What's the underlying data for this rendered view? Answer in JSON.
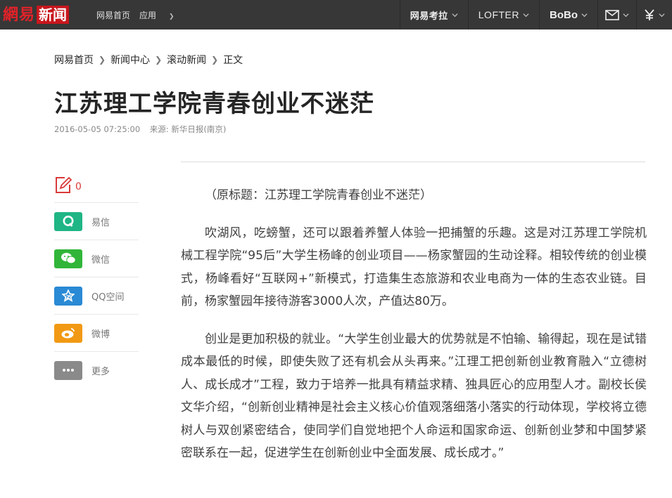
{
  "topbar": {
    "logo_main": "網易",
    "logo_sub": "新闻",
    "nav_home": "网易首页",
    "nav_apps": "应用",
    "kaola": "网易考拉",
    "lofter": "LOFTER",
    "bobo": "BoBo"
  },
  "colors": {
    "topbar_bg": "#373737",
    "logo_red": "#c8161d",
    "yixin": "#1fb585",
    "weixin": "#31b539",
    "qzone": "#2a8ad5",
    "weibo": "#f29913",
    "more": "#8a8a8a"
  },
  "breadcrumb": [
    "网易首页",
    "新闻中心",
    "滚动新闻",
    "正文"
  ],
  "article": {
    "title": "江苏理工学院青春创业不迷茫",
    "datetime": "2016-05-05 07:25:00",
    "source": "来源: 新华日报(南京)",
    "paragraphs": [
      "（原标题：江苏理工学院青春创业不迷茫）",
      "吹湖风，吃螃蟹，还可以跟着养蟹人体验一把捕蟹的乐趣。这是对江苏理工学院机械工程学院“95后”大学生杨峰的创业项目——杨家蟹园的生动诠释。相较传统的创业模式，杨峰看好“互联网+”新模式，打造集生态旅游和农业电商为一体的生态农业链。目前，杨家蟹园年接待游客3000人次，产值达80万。",
      "创业是更加积极的就业。“大学生创业最大的优势就是不怕输、输得起，现在是试错成本最低的时候，即使失败了还有机会从头再来。”江理工把创新创业教育融入“立德树人、成长成才”工程，致力于培养一批具有精益求精、独具匠心的应用型人才。副校长侯文华介绍，“创新创业精神是社会主义核心价值观落细落小落实的行动体现，学校将立德树人与双创紧密结合，使同学们自觉地把个人命运和国家命运、创新创业梦和中国梦紧密联系在一起，促进学生在创新创业中全面发展、成长成才。”"
    ]
  },
  "comments": {
    "count": "0",
    "icon": "comment-edit-icon"
  },
  "share": [
    {
      "label": "易信",
      "icon": "yixin-icon"
    },
    {
      "label": "微信",
      "icon": "wechat-icon"
    },
    {
      "label": "QQ空间",
      "icon": "qzone-icon"
    },
    {
      "label": "微博",
      "icon": "weibo-icon"
    },
    {
      "label": "更多",
      "icon": "more-icon"
    }
  ]
}
